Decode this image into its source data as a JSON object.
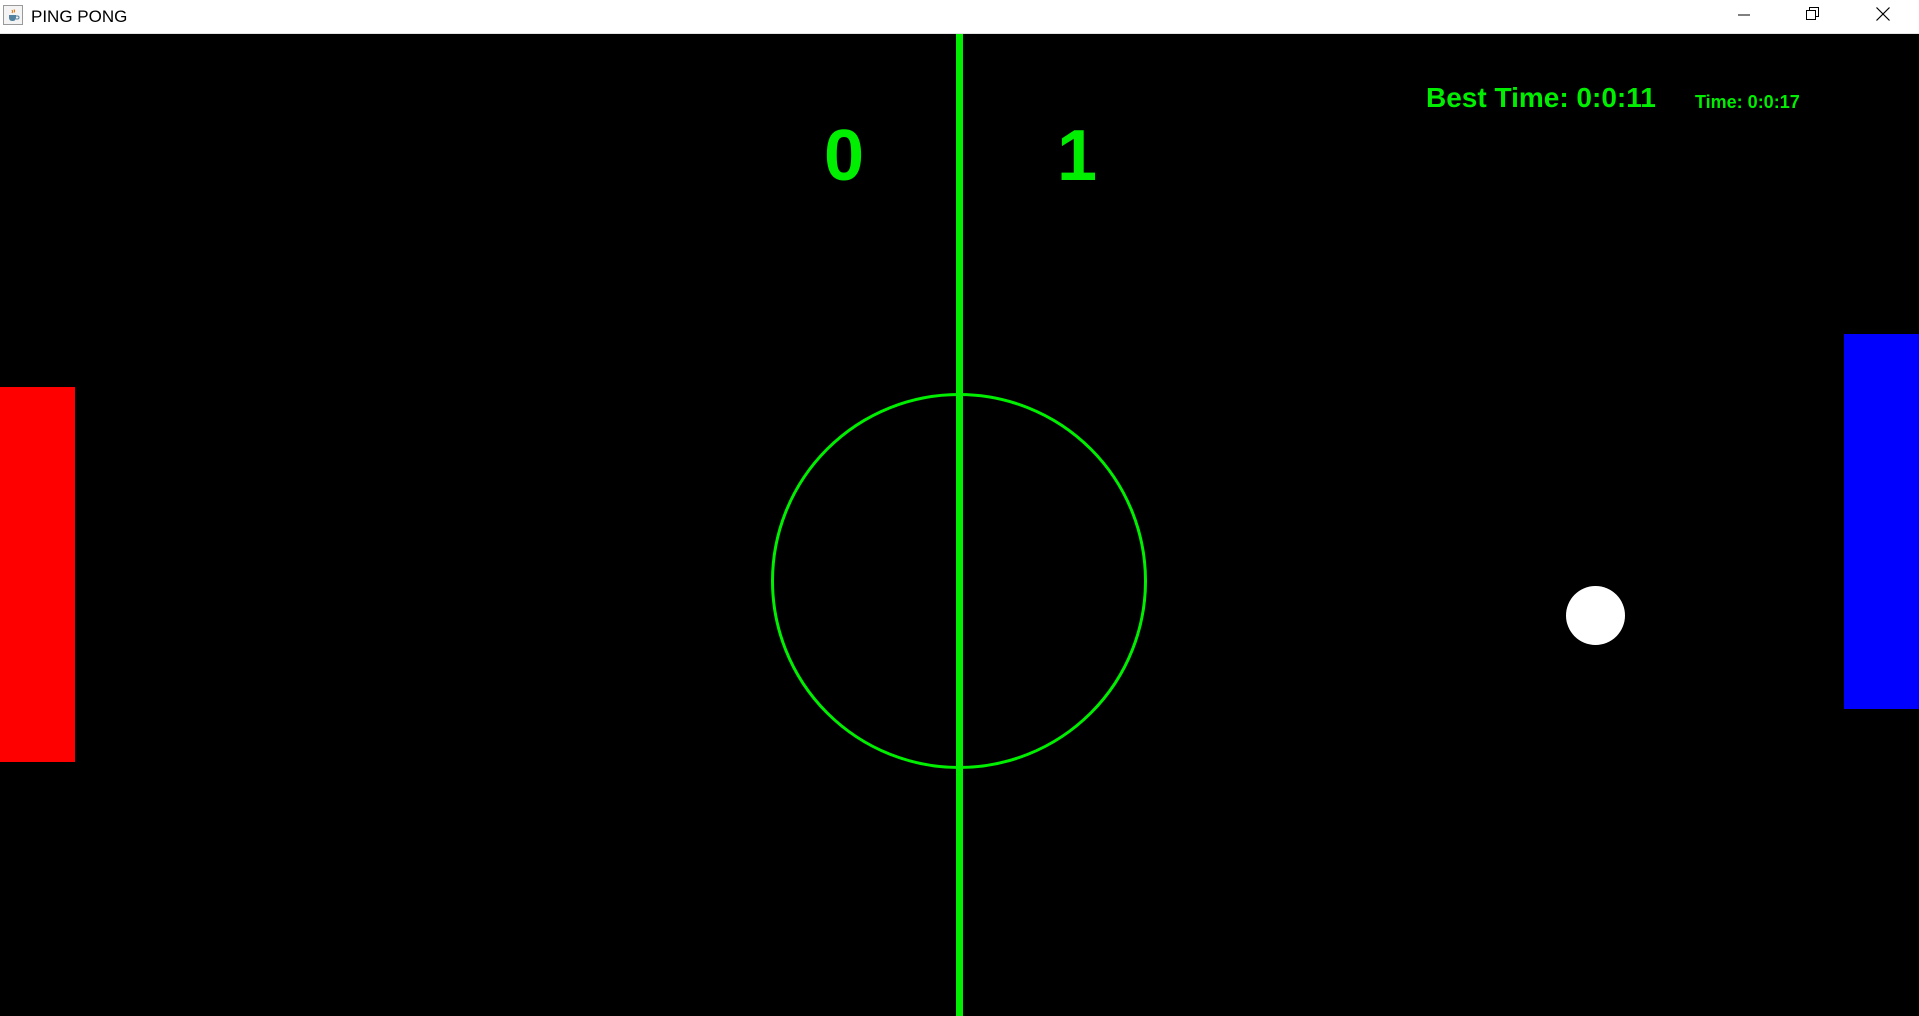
{
  "window": {
    "title": "PING PONG",
    "app_icon": "java-cup-icon",
    "controls": {
      "minimize_icon": "minimize-icon",
      "restore_icon": "restore-icon",
      "close_icon": "close-icon"
    }
  },
  "game": {
    "score_left": "0",
    "score_right": "1",
    "best_time": "Best Time: 0:0:11",
    "time": "Time: 0:0:17",
    "colors": {
      "background": "#000000",
      "field_lines": "#00ee00",
      "text": "#00ee00",
      "left_paddle": "#ff0000",
      "right_paddle": "#0000ff",
      "ball": "#ffffff"
    }
  }
}
